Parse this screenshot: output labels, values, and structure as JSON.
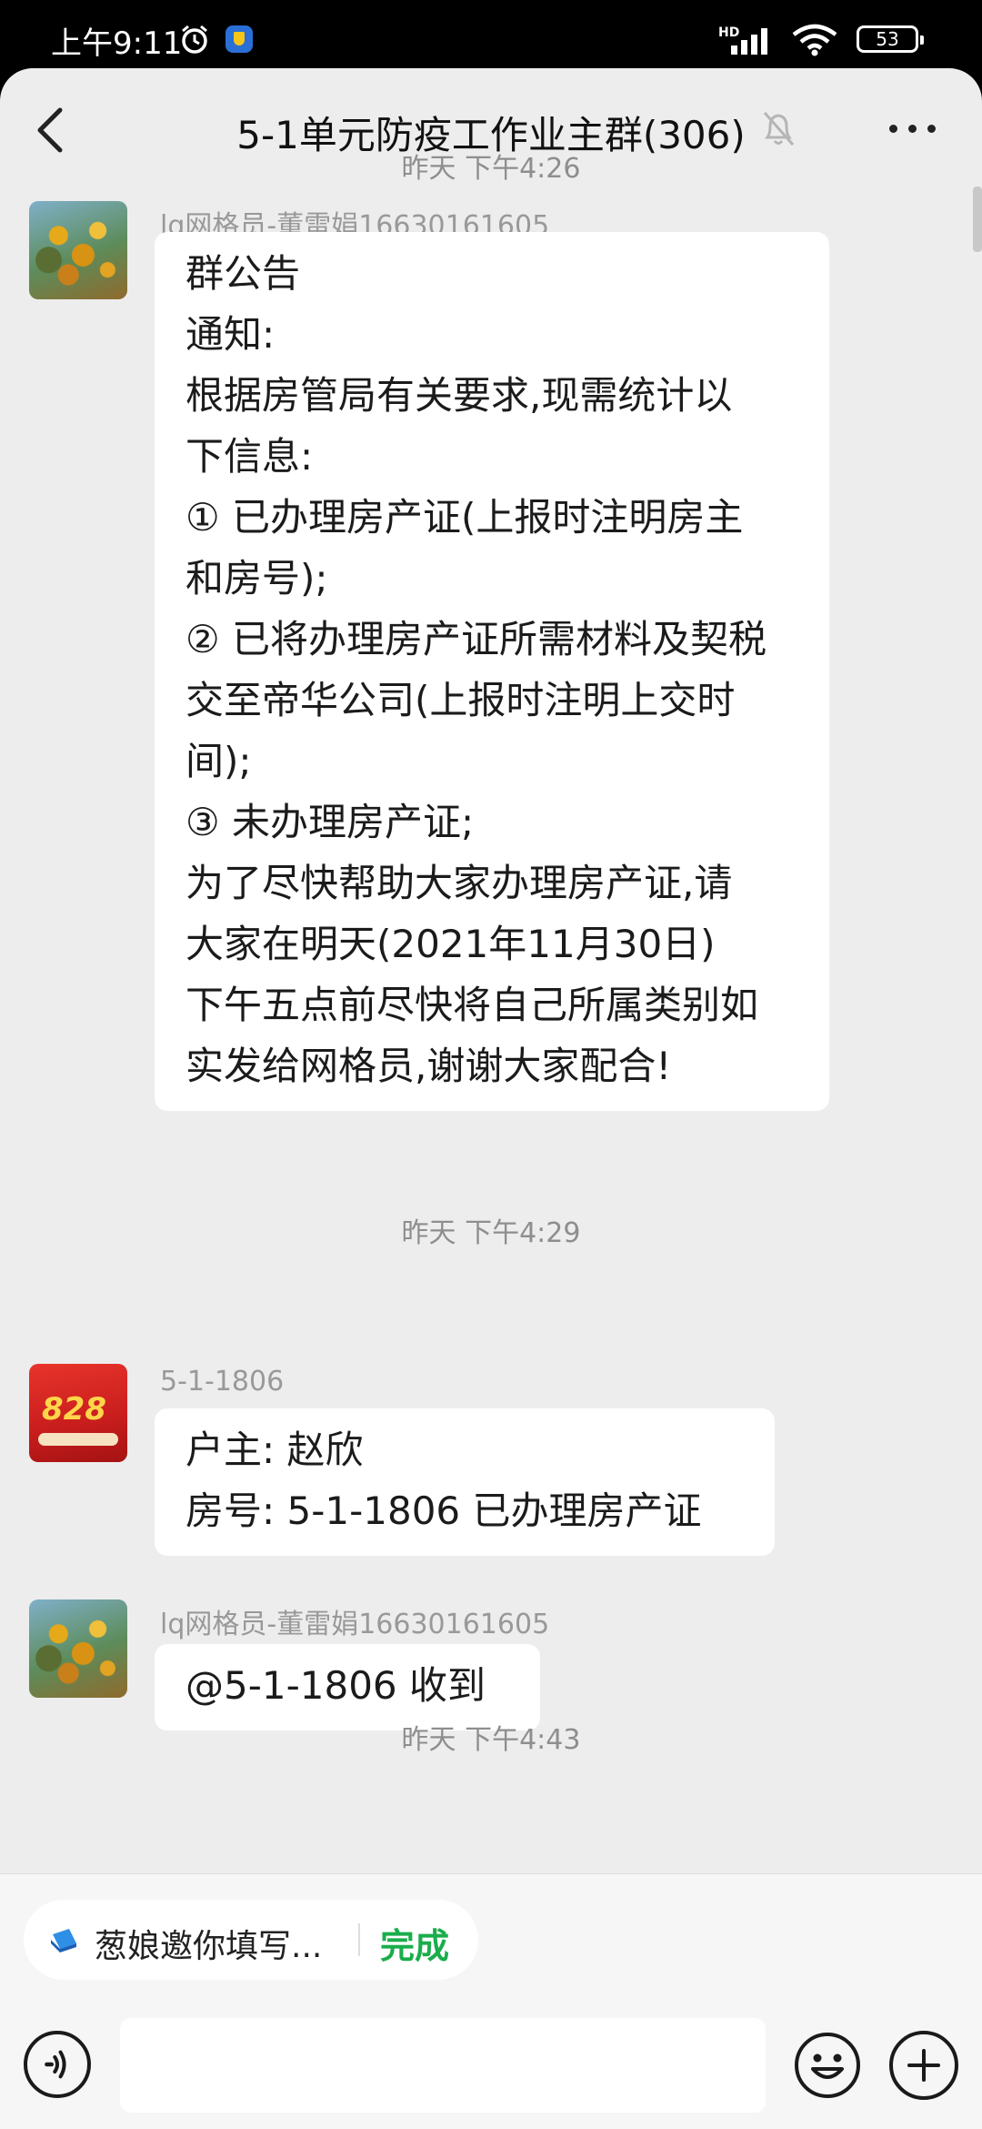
{
  "status_bar": {
    "time": "上午9:11",
    "network": "HD",
    "battery": "53"
  },
  "header": {
    "title": "5-1单元防疫工作业主群(306)"
  },
  "messages": [
    {
      "timestamp": "昨天 下午4:26",
      "sender": "lq网格员-董雷娟16630161605",
      "lines": [
        "群公告",
        "通知:",
        "根据房管局有关要求,现需统计以",
        "下信息:",
        "① 已办理房产证(上报时注明房主",
        "和房号);",
        "② 已将办理房产证所需材料及契税",
        "交至帝华公司(上报时注明上交时",
        "间);",
        "③ 未办理房产证;",
        "为了尽快帮助大家办理房产证,请",
        "大家在明天(2021年11月30日)",
        "下午五点前尽快将自己所属类别如",
        "实发给网格员,谢谢大家配合!"
      ]
    },
    {
      "timestamp": "昨天 下午4:29",
      "sender": "5-1-1806",
      "avatar_text": "828",
      "lines": [
        "户主: 赵欣",
        "房号: 5-1-1806 已办理房产证"
      ]
    },
    {
      "sender": "lq网格员-董雷娟16630161605",
      "lines": [
        "@5-1-1806  收到"
      ]
    },
    {
      "timestamp": "昨天 下午4:43"
    }
  ],
  "todo": {
    "text": "葱娘邀你填写...",
    "action": "完成"
  },
  "icons": {
    "back": "chevron-left-icon",
    "mute": "bell-off-icon",
    "more": "more-dots-icon",
    "voice": "voice-icon",
    "emoji": "emoji-icon",
    "plus": "plus-icon"
  },
  "colors": {
    "accent_green": "#1aad4b",
    "chat_background": "#ededed",
    "bubble": "#ffffff"
  }
}
